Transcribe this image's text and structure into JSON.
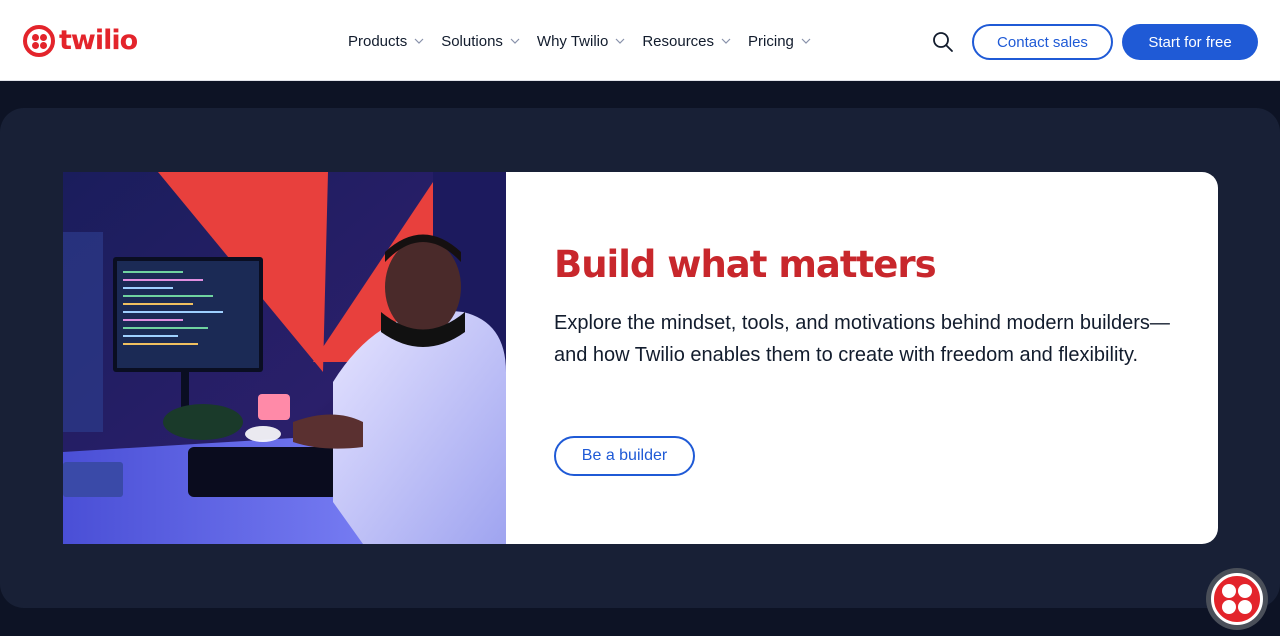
{
  "brand": {
    "logo_text": "twilio",
    "accent": "#e3242b",
    "link_blue": "#1f5ad6"
  },
  "nav": {
    "items": [
      {
        "label": "Products"
      },
      {
        "label": "Solutions"
      },
      {
        "label": "Why Twilio"
      },
      {
        "label": "Resources"
      },
      {
        "label": "Pricing"
      }
    ],
    "search_icon": "search-icon",
    "contact_label": "Contact sales",
    "start_label": "Start for free"
  },
  "hero": {
    "photo_icon": "developer-at-desk-photo",
    "title": "Build what matters",
    "title_color": "#c8272c",
    "description": "Explore the mindset, tools, and motivations behind modern builders—and how Twilio enables them to create with freedom and flexibility.",
    "cta_label": "Be a builder"
  },
  "chat_widget": {
    "icon": "twilio-logo-icon"
  }
}
